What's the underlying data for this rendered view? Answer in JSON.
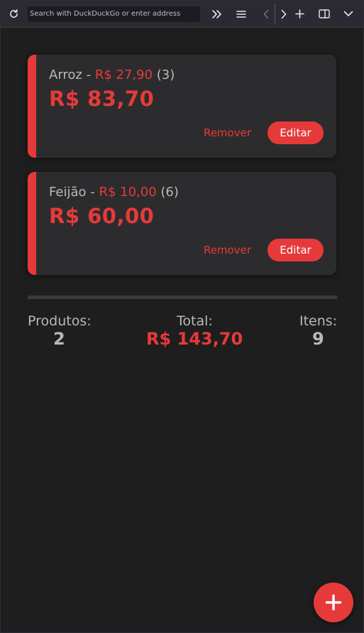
{
  "browser": {
    "address_placeholder": "Search with DuckDuckGo or enter address",
    "icons": [
      "reload-icon",
      "overflow-chevrons-icon",
      "menu-icon",
      "back-icon",
      "forward-icon",
      "new-tab-icon",
      "sidebar-icon",
      "dropdown-icon"
    ]
  },
  "colors": {
    "accent": "#e63a3a",
    "background": "#1e1e1e",
    "card": "#2c2c2e",
    "muted_text": "#b9b9b9"
  },
  "products": [
    {
      "name": "Arroz",
      "separator": " - ",
      "unit_price": "R$ 27,90",
      "quantity": " (3)",
      "total": "R$ 83,70",
      "remove_label": "Remover",
      "edit_label": "Editar"
    },
    {
      "name": "Feijão",
      "separator": " - ",
      "unit_price": "R$ 10,00",
      "quantity": " (6)",
      "total": "R$ 60,00",
      "remove_label": "Remover",
      "edit_label": "Editar"
    }
  ],
  "summary": {
    "products_label": "Produtos:",
    "products_value": "2",
    "total_label": "Total:",
    "total_value": "R$ 143,70",
    "items_label": "Itens:",
    "items_value": "9"
  },
  "fab": {
    "icon": "plus-icon"
  }
}
